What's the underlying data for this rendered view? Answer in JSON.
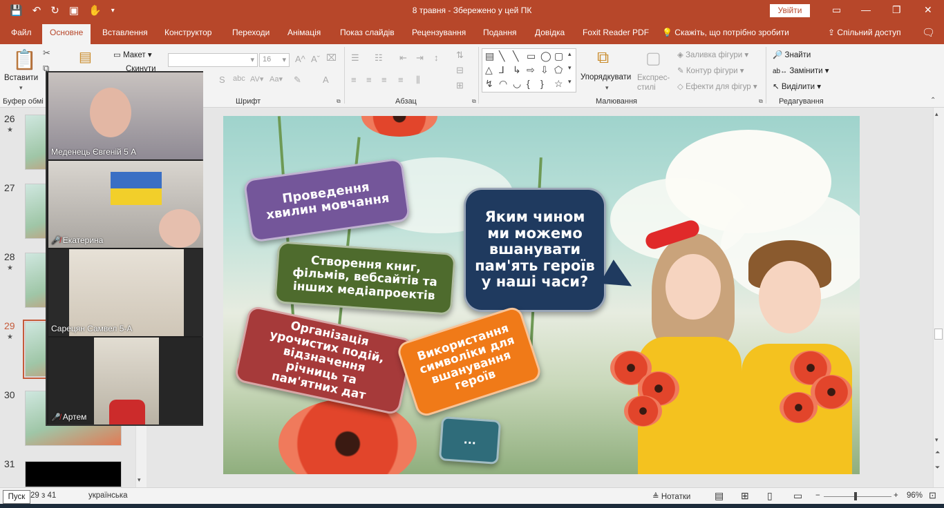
{
  "app": {
    "title": "8 травня  -  Збережено у цей ПК",
    "signin_label": "Увійти",
    "accent": "#b7472a"
  },
  "tabs": [
    "Файл",
    "Основне",
    "Вставлення",
    "Конструктор",
    "Переходи",
    "Анімація",
    "Показ слайдів",
    "Рецензування",
    "Подання",
    "Довідка",
    "Foxit Reader PDF"
  ],
  "tell_me": "Скажіть, що потрібно зробити",
  "share": "Спільний доступ",
  "ribbon": {
    "paste": "Вставити",
    "layout": "Макет",
    "reset": "Скинути",
    "font_size": "16",
    "groups": {
      "clipboard": "Буфер обмі",
      "font": "Шрифт",
      "paragraph": "Абзац",
      "drawing": "Малювання",
      "editing": "Редагування"
    },
    "arrange": "Упорядкувати",
    "quick_styles": "Експрес-стилі",
    "shape_fill": "Заливка фігури",
    "shape_outline": "Контур фігури",
    "shape_effects": "Ефекти для фігур",
    "find": "Знайти",
    "replace": "Замінити",
    "select": "Виділити"
  },
  "thumbnails": [
    {
      "num": "26",
      "star": "★"
    },
    {
      "num": "27",
      "star": ""
    },
    {
      "num": "28",
      "star": "★"
    },
    {
      "num": "29",
      "star": "★"
    },
    {
      "num": "30",
      "star": ""
    },
    {
      "num": "31",
      "star": ""
    }
  ],
  "slide": {
    "q": "Яким чином ми можемо вшанувати пам'ять героїв у наші часи?",
    "b1": "Проведення хвилин мовчання",
    "b2": "Створення книг, фільмів, вебсайтів та інших медіапроектів",
    "b3": "Організація урочистих подій, відзначення річниць та пам'ятних дат",
    "b4": "Використання символіки для вшанування героїв",
    "b5": "..."
  },
  "call": {
    "participants": [
      "Меденець Євгеній 5 А",
      "Екатерина",
      "Сарецян Самвел 5-А",
      "Артем"
    ]
  },
  "status": {
    "start": "Пуск",
    "slide_counter": "29 з 41",
    "language": "українська",
    "notes": "Нотатки",
    "zoom": "96%"
  }
}
